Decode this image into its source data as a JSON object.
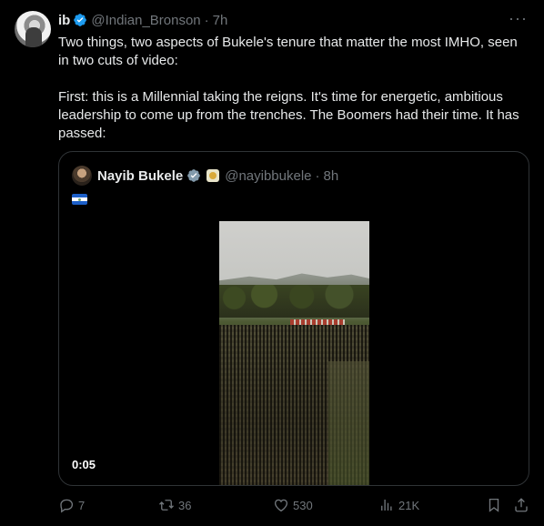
{
  "tweet": {
    "author_name": "ib",
    "author_handle": "@Indian_Bronson",
    "separator": "·",
    "time": "7h",
    "more": "···",
    "paragraphs": [
      "Two things, two aspects of Bukele's tenure that matter the most IMHO, seen in two cuts of video:",
      "First: this is a Millennial taking the reigns. It's time for energetic, ambitious leadership to come up from the trenches. The Boomers had their time. It has passed:"
    ]
  },
  "quoted": {
    "author_name": "Nayib Bukele",
    "author_handle": "@nayibbukele",
    "separator": "·",
    "time": "8h",
    "flag": "El Salvador flag emoji",
    "video_time": "0:05"
  },
  "actions": {
    "replies": "7",
    "retweets": "36",
    "likes": "530",
    "views": "21K"
  },
  "colors": {
    "background": "#000000",
    "text": "#e7e9ea",
    "secondary": "#71767b",
    "verified": "#1d9bf0",
    "border": "#2f3336"
  }
}
